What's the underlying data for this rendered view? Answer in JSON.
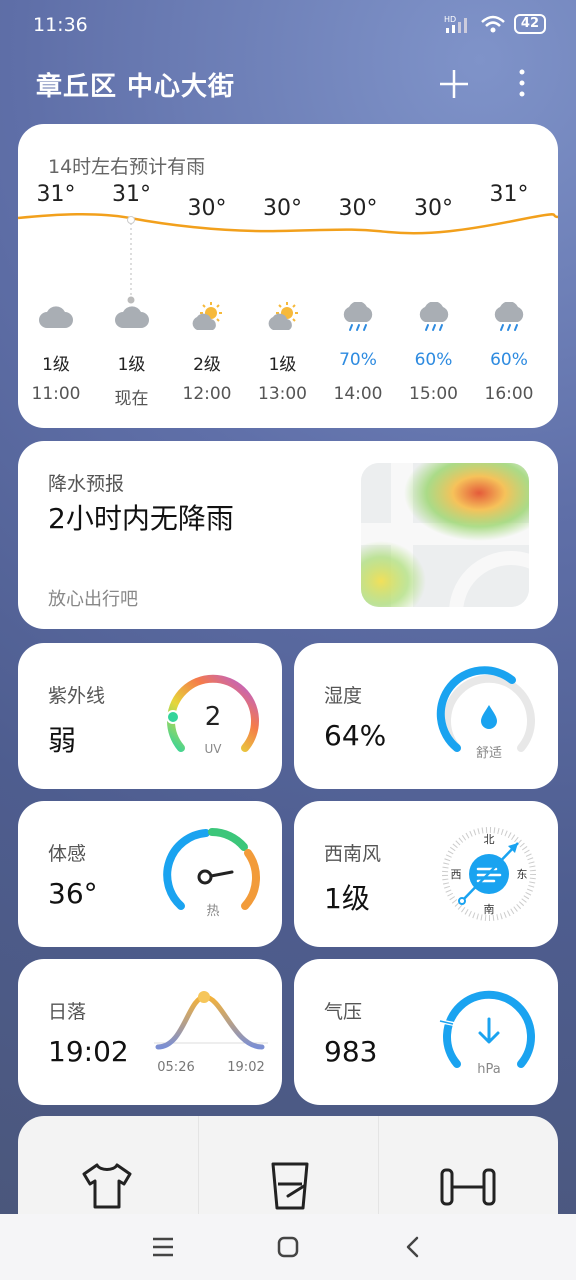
{
  "status": {
    "time": "11:36",
    "battery": "42",
    "network": "HD"
  },
  "header": {
    "location": "章丘区 中心大街"
  },
  "hourly": {
    "note": "14时左右预计有雨",
    "hours": [
      {
        "temp": "31°",
        "icon": "cloudy-icon",
        "wind": "1级",
        "time": "11:00"
      },
      {
        "temp": "31°",
        "icon": "cloudy-icon",
        "wind": "1级",
        "time": "现在"
      },
      {
        "temp": "30°",
        "icon": "partly-sunny-icon",
        "wind": "2级",
        "time": "12:00"
      },
      {
        "temp": "30°",
        "icon": "partly-sunny-icon",
        "wind": "1级",
        "time": "13:00"
      },
      {
        "temp": "30°",
        "icon": "rain-icon",
        "wind": "70%",
        "time": "14:00"
      },
      {
        "temp": "30°",
        "icon": "rain-icon",
        "wind": "60%",
        "time": "15:00"
      },
      {
        "temp": "31°",
        "icon": "rain-icon",
        "wind": "60%",
        "time": "16:00"
      }
    ]
  },
  "precip": {
    "title": "降水预报",
    "main": "2小时内无降雨",
    "sub": "放心出行吧"
  },
  "uv": {
    "label": "紫外线",
    "value": "弱",
    "gauge_value": "2",
    "unit": "UV"
  },
  "humidity": {
    "label": "湿度",
    "value": "64%",
    "gauge_text": "舒适"
  },
  "feels": {
    "label": "体感",
    "value": "36°",
    "gauge_text": "热"
  },
  "wind": {
    "label": "西南风",
    "value": "1级",
    "north": "北",
    "south": "南",
    "east": "东",
    "west": "西"
  },
  "sunset": {
    "label": "日落",
    "value": "19:02",
    "sunrise_time": "05:26",
    "sunset_time": "19:02"
  },
  "pressure": {
    "label": "气压",
    "value": "983",
    "unit": "hPa"
  },
  "colors": {
    "accent_blue": "#1aa3f0",
    "temp_line": "#f2a01c",
    "rain_text": "#2e8be0"
  }
}
